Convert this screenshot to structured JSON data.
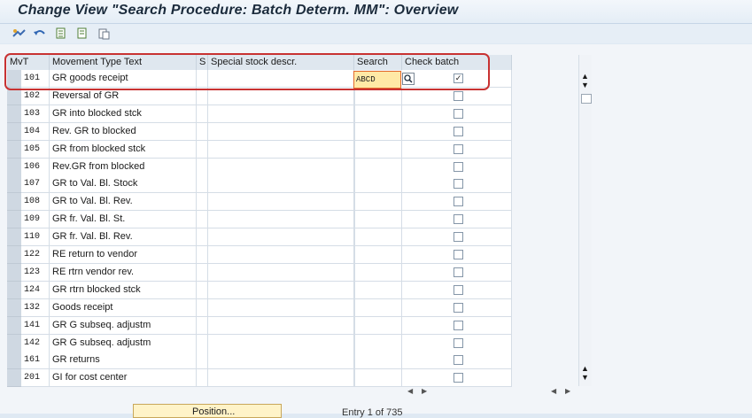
{
  "window": {
    "title": "Change View \"Search Procedure: Batch Determ. MM\": Overview"
  },
  "toolbar": {
    "icons": [
      "change-display-icon",
      "undo-icon",
      "select-all-icon",
      "deselect-all-icon",
      "copy-icon"
    ]
  },
  "table": {
    "columns": {
      "mvt": "MvT",
      "movement_type_text": "Movement Type Text",
      "s": "S",
      "special_stock": "Special stock descr.",
      "search": "Search",
      "check_batch": "Check batch"
    },
    "rows": [
      {
        "mvt": "101",
        "text": "GR goods receipt",
        "search": "ABCD",
        "checked": true
      },
      {
        "mvt": "102",
        "text": "Reversal of GR",
        "search": "",
        "checked": false
      },
      {
        "mvt": "103",
        "text": "GR into blocked stck",
        "search": "",
        "checked": false
      },
      {
        "mvt": "104",
        "text": "Rev. GR to blocked",
        "search": "",
        "checked": false
      },
      {
        "mvt": "105",
        "text": "GR from blocked stck",
        "search": "",
        "checked": false
      },
      {
        "mvt": "106",
        "text": "Rev.GR from blocked",
        "search": "",
        "checked": false
      },
      {
        "mvt": "107",
        "text": "GR to Val. Bl. Stock",
        "search": "",
        "checked": false
      },
      {
        "mvt": "108",
        "text": "GR to Val. Bl. Rev.",
        "search": "",
        "checked": false
      },
      {
        "mvt": "109",
        "text": "GR fr. Val. Bl. St.",
        "search": "",
        "checked": false
      },
      {
        "mvt": "110",
        "text": "GR fr. Val. Bl. Rev.",
        "search": "",
        "checked": false
      },
      {
        "mvt": "122",
        "text": "RE return to vendor",
        "search": "",
        "checked": false
      },
      {
        "mvt": "123",
        "text": "RE rtrn vendor rev.",
        "search": "",
        "checked": false
      },
      {
        "mvt": "124",
        "text": "GR rtrn blocked stck",
        "search": "",
        "checked": false
      },
      {
        "mvt": "132",
        "text": "Goods receipt",
        "search": "",
        "checked": false
      },
      {
        "mvt": "141",
        "text": "GR G subseq. adjustm",
        "search": "",
        "checked": false
      },
      {
        "mvt": "142",
        "text": "GR G subseq. adjustm",
        "search": "",
        "checked": false
      },
      {
        "mvt": "161",
        "text": "GR returns",
        "search": "",
        "checked": false
      },
      {
        "mvt": "201",
        "text": "GI for cost center",
        "search": "",
        "checked": false
      }
    ]
  },
  "footer": {
    "position_button": "Position...",
    "entry_text": "Entry 1 of 735"
  },
  "colors": {
    "accent_border": "#c83232",
    "active_input": "#ffe9a6"
  }
}
